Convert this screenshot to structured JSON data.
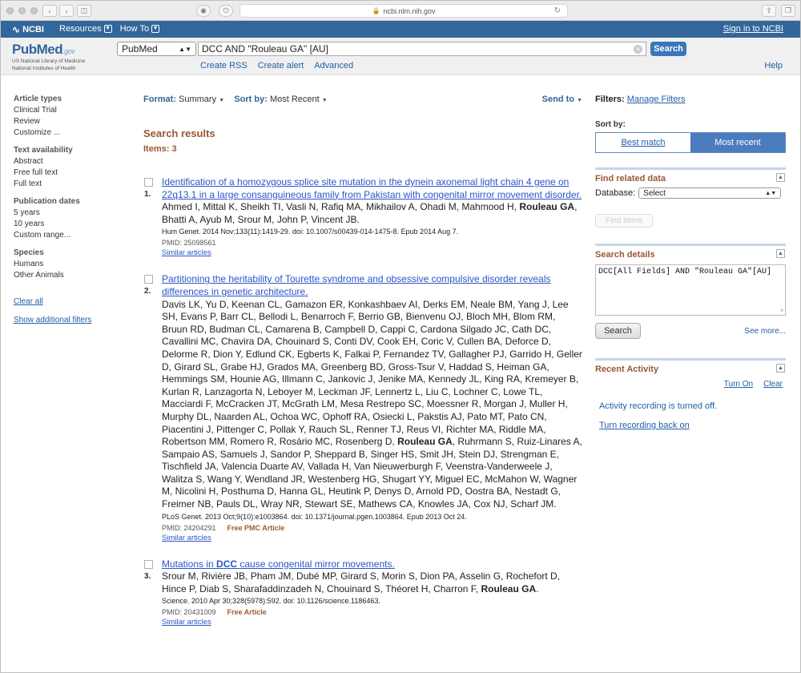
{
  "browser": {
    "url": "ncbi.nlm.nih.gov"
  },
  "ncbi_bar": {
    "logo": "NCBI",
    "menus": [
      "Resources",
      "How To"
    ],
    "signin": "Sign in to NCBI"
  },
  "pubmed_header": {
    "logo": "PubMed",
    "logo_suffix": ".gov",
    "logo_sub1": "US National Library of Medicine",
    "logo_sub2": "National Institutes of Health",
    "database": "PubMed",
    "query": "DCC AND \"Rouleau GA\" [AU]",
    "search_button": "Search",
    "links": [
      "Create RSS",
      "Create alert",
      "Advanced"
    ],
    "help": "Help"
  },
  "left_nav": {
    "groups": [
      {
        "heading": "Article types",
        "items": [
          "Clinical Trial",
          "Review",
          "Customize ..."
        ]
      },
      {
        "heading": "Text availability",
        "items": [
          "Abstract",
          "Free full text",
          "Full text"
        ]
      },
      {
        "heading": "Publication dates",
        "items": [
          "5 years",
          "10 years",
          "Custom range..."
        ]
      },
      {
        "heading": "Species",
        "items": [
          "Humans",
          "Other Animals"
        ]
      }
    ],
    "clear_all": "Clear all",
    "show_filters": "Show additional filters"
  },
  "main": {
    "format_label": "Format:",
    "format_value": "Summary",
    "sort_label": "Sort by:",
    "sort_value": "Most Recent",
    "send_to": "Send to",
    "results_title": "Search results",
    "items_count": "Items: 3",
    "results": [
      {
        "num": "1.",
        "title": "Identification of a homozygous splice site mutation in the dynein axonemal light chain 4 gene on 22q13.1 in a large consanguineous family from Pakistan with congenital mirror movement disorder.",
        "authors_before": "Ahmed I, Mittal K, Sheikh TI, Vasli N, Rafiq MA, Mikhailov A, Ohadi M, Mahmood H, ",
        "authors_bold": "Rouleau GA",
        "authors_after": ", Bhatti A, Ayub M, Srour M, John P, Vincent JB.",
        "journal": "Hum Genet. 2014 Nov;133(11):1419-29. doi: 10.1007/s00439-014-1475-8. Epub 2014 Aug 7.",
        "pmid": "PMID: 25098561",
        "free": "",
        "similar": "Similar articles"
      },
      {
        "num": "2.",
        "title": "Partitioning the heritability of Tourette syndrome and obsessive compulsive disorder reveals differences in genetic architecture.",
        "authors_before": "Davis LK, Yu D, Keenan CL, Gamazon ER, Konkashbaev AI, Derks EM, Neale BM, Yang J, Lee SH, Evans P, Barr CL, Bellodi L, Benarroch F, Berrio GB, Bienvenu OJ, Bloch MH, Blom RM, Bruun RD, Budman CL, Camarena B, Campbell D, Cappi C, Cardona Silgado JC, Cath DC, Cavallini MC, Chavira DA, Chouinard S, Conti DV, Cook EH, Coric V, Cullen BA, Deforce D, Delorme R, Dion Y, Edlund CK, Egberts K, Falkai P, Fernandez TV, Gallagher PJ, Garrido H, Geller D, Girard SL, Grabe HJ, Grados MA, Greenberg BD, Gross-Tsur V, Haddad S, Heiman GA, Hemmings SM, Hounie AG, Illmann C, Jankovic J, Jenike MA, Kennedy JL, King RA, Kremeyer B, Kurlan R, Lanzagorta N, Leboyer M, Leckman JF, Lennertz L, Liu C, Lochner C, Lowe TL, Macciardi F, McCracken JT, McGrath LM, Mesa Restrepo SC, Moessner R, Morgan J, Muller H, Murphy DL, Naarden AL, Ochoa WC, Ophoff RA, Osiecki L, Pakstis AJ, Pato MT, Pato CN, Piacentini J, Pittenger C, Pollak Y, Rauch SL, Renner TJ, Reus VI, Richter MA, Riddle MA, Robertson MM, Romero R, Rosário MC, Rosenberg D, ",
        "authors_bold": "Rouleau GA",
        "authors_after": ", Ruhrmann S, Ruiz-Linares A, Sampaio AS, Samuels J, Sandor P, Sheppard B, Singer HS, Smit JH, Stein DJ, Strengman E, Tischfield JA, Valencia Duarte AV, Vallada H, Van Nieuwerburgh F, Veenstra-Vanderweele J, Walitza S, Wang Y, Wendland JR, Westenberg HG, Shugart YY, Miguel EC, McMahon W, Wagner M, Nicolini H, Posthuma D, Hanna GL, Heutink P, Denys D, Arnold PD, Oostra BA, Nestadt G, Freimer NB, Pauls DL, Wray NR, Stewart SE, Mathews CA, Knowles JA, Cox NJ, Scharf JM.",
        "journal": "PLoS Genet. 2013 Oct;9(10):e1003864. doi: 10.1371/journal.pgen.1003864. Epub 2013 Oct 24.",
        "pmid": "PMID: 24204291",
        "free": "Free PMC Article",
        "similar": "Similar articles"
      },
      {
        "num": "3.",
        "title_before": "Mutations in ",
        "title_bold": "DCC",
        "title_after": " cause congenital mirror movements.",
        "authors_before": "Srour M, Rivière JB, Pham JM, Dubé MP, Girard S, Morin S, Dion PA, Asselin G, Rochefort D, Hince P, Diab S, Sharafaddinzadeh N, Chouinard S, Théoret H, Charron F, ",
        "authors_bold": "Rouleau GA",
        "authors_after": ".",
        "journal": "Science. 2010 Apr 30;328(5978):592. doi: 10.1126/science.1186463.",
        "pmid": "PMID: 20431009",
        "free": "Free Article",
        "similar": "Similar articles"
      }
    ]
  },
  "right_col": {
    "filters_label": "Filters:",
    "manage_filters": "Manage Filters",
    "sort_by": "Sort by:",
    "best_match": "Best match",
    "most_recent": "Most recent",
    "related_title": "Find related data",
    "database_label": "Database:",
    "database_value": "Select",
    "find_items": "Find items",
    "details_title": "Search details",
    "details_query": "DCC[All Fields] AND \"Rouleau GA\"[AU]",
    "details_search": "Search",
    "see_more": "See more...",
    "activity_title": "Recent Activity",
    "turn_on": "Turn On",
    "clear": "Clear",
    "activity_msg": "Activity recording is turned off.",
    "activity_link": "Turn recording back on"
  }
}
